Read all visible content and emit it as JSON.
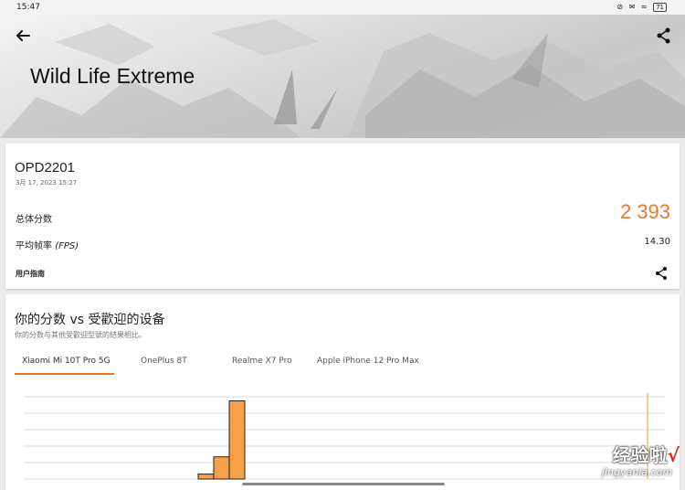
{
  "status_bar": {
    "time": "15:47",
    "icons": "⊘ ✉ ≈",
    "battery": "71"
  },
  "header": {
    "title": "Wild Life Extreme",
    "back_icon": "arrow-left-icon",
    "share_icon": "share-icon"
  },
  "result": {
    "device": "OPD2201",
    "date": "3月 17, 2023 15:27",
    "overall_score_label": "总体分数",
    "overall_score_value": "2 393",
    "fps_label_prefix": "平均帧率 ",
    "fps_label_suffix": "(FPS)",
    "fps_value": "14.30",
    "user_guide_label": "用户指南",
    "accent_color": "#e8792a"
  },
  "comparison": {
    "title": "你的分数 vs 受歡迎的设备",
    "subtitle": "你的分数与其他受歡迎型號的结果相比。",
    "tabs": [
      {
        "label": "Xiaomi Mi 10T Pro 5G",
        "active": true
      },
      {
        "label": "OnePlus 8T",
        "active": false
      },
      {
        "label": "Realme X7 Pro",
        "active": false
      },
      {
        "label": "Apple iPhone 12 Pro Max",
        "active": false
      }
    ]
  },
  "chart_data": {
    "type": "bar",
    "title": "",
    "xlabel": "",
    "ylabel": "",
    "bar_color": "#f7a04a",
    "bins": [
      {
        "label": "",
        "relative_height": 0.06
      },
      {
        "label": "",
        "relative_height": 0.27
      },
      {
        "label": "",
        "relative_height": 0.95
      }
    ],
    "marker_color": "#e8c07a"
  },
  "watermark": {
    "text": "经验啦",
    "check": "√",
    "sub": "jingyanla.com"
  }
}
